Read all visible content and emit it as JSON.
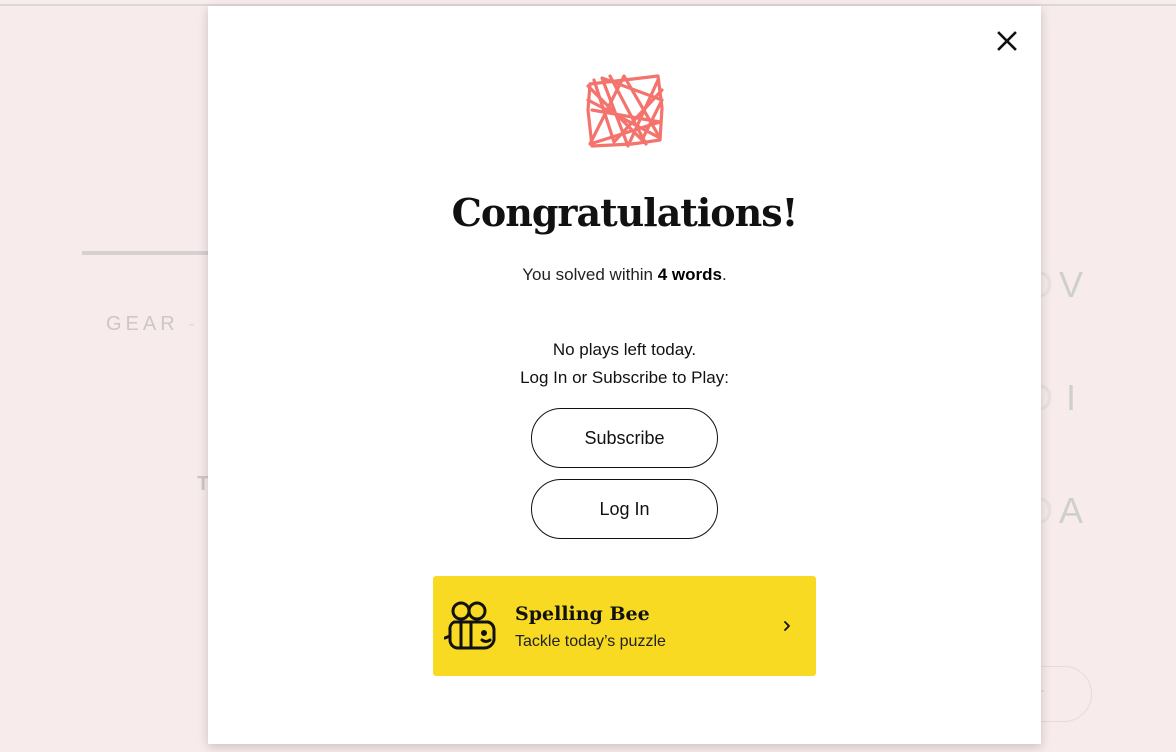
{
  "background": {
    "hint_text": "GEAR",
    "hint_partial": "R",
    "side_letter": "T",
    "letters": [
      "V",
      "I",
      "A"
    ],
    "enter_label": "ter"
  },
  "modal": {
    "title": "Congratulations!",
    "solved_prefix": "You solved within ",
    "solved_count": "4 words",
    "solved_suffix": ".",
    "no_plays": "No plays left today.",
    "prompt": "Log In or Subscribe to Play:",
    "subscribe_label": "Subscribe",
    "login_label": "Log In",
    "promo": {
      "title": "Spelling Bee",
      "subtitle": "Tackle today’s puzzle"
    }
  },
  "colors": {
    "accent_logo": "#f4736c",
    "promo_bg": "#f7da21",
    "page_bg": "#f7ebec"
  },
  "icons": [
    "close-icon",
    "letter-boxed-logo-icon",
    "bee-icon",
    "chevron-right-icon"
  ]
}
